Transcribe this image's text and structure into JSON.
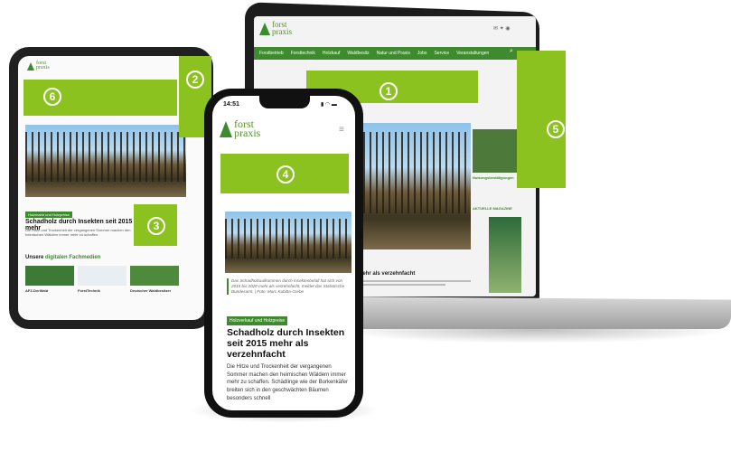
{
  "brand": {
    "logo_line1": "forst",
    "logo_line2": "praxis"
  },
  "laptop": {
    "nav": [
      "Forstbetrieb",
      "Forsttechnik",
      "Holzkauf",
      "Waldbesitz",
      "Natur und Praxis",
      "Jobs",
      "Service",
      "Veranstaltungen"
    ],
    "headline": "2015 mehr als verzehnfacht",
    "tag": "Nutzungsbestätigungen",
    "section": "AKTUELLE MAGAZINE"
  },
  "tablet": {
    "tag": "Holzmarkt und Holzpreise",
    "headline": "Schadholz durch Insekten seit 2015 mehr",
    "body": "Die Hitze und Trockenheit der vergangenen Sommer machen den heimischen Wäldern immer mehr zu schaffen.",
    "mags_title_plain": "Unsere",
    "mags_title_accent": "digitalen Fachmedien",
    "mags": [
      "AFZ-DerWald",
      "ForstTechnik",
      "Deutscher Waldbesitzer"
    ]
  },
  "phone": {
    "time": "14:51",
    "caption": "Das Schadholzaufkommen durch Insektenbefall hat sich von 2015 bis 2020 mehr als verzehnfacht, meldet das Statistische Bundesamt. | Foto: Marc Kubitta-Grebe",
    "tag": "Holzverkauf und Holzpreise",
    "headline": "Schadholz durch Insekten seit 2015 mehr als verzehnfacht",
    "body": "Die Hitze und Trockenheit der vergangenen Sommer machen den heimischen Wäldern immer mehr zu schaffen. Schädlinge wie der Borkenkäfer breiten sich in den geschwächten Bäumen besonders schnell"
  },
  "badges": [
    "1",
    "2",
    "3",
    "4",
    "5",
    "6"
  ],
  "colors": {
    "accent": "#8cc21f",
    "nav": "#3f8a2e"
  }
}
